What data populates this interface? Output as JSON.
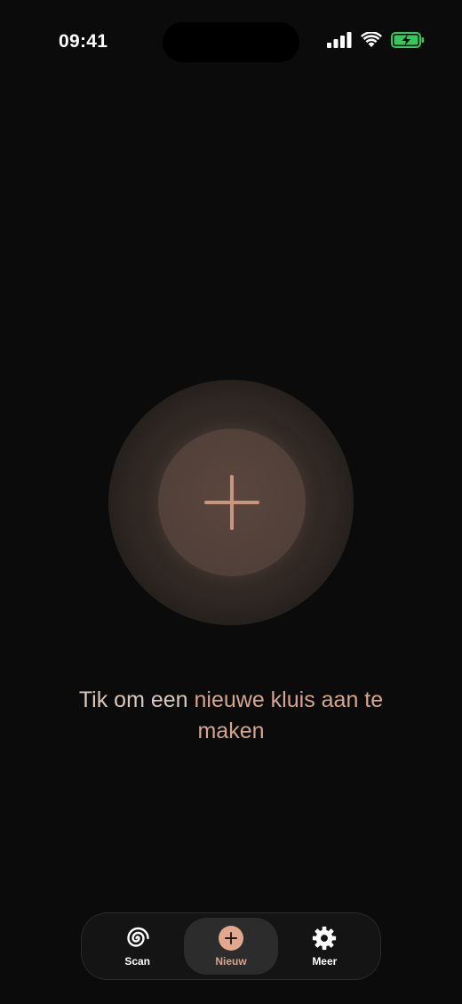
{
  "status_bar": {
    "time": "09:41",
    "icons": [
      "signal-icon",
      "wifi-icon",
      "battery-charging-icon"
    ]
  },
  "main": {
    "create_button_icon": "plus-icon",
    "hint_prefix": "Tik om een ",
    "hint_accent": "nieuwe kluis aan te maken"
  },
  "tab_bar": {
    "tabs": [
      {
        "label": "Scan",
        "icon": "spiral-icon",
        "active": false
      },
      {
        "label": "Nieuw",
        "icon": "add-circle-icon",
        "active": true
      },
      {
        "label": "Meer",
        "icon": "gear-icon",
        "active": false
      }
    ]
  },
  "colors": {
    "background": "#0b0b0b",
    "accent": "#d5a58c",
    "battery": "#34c759"
  }
}
